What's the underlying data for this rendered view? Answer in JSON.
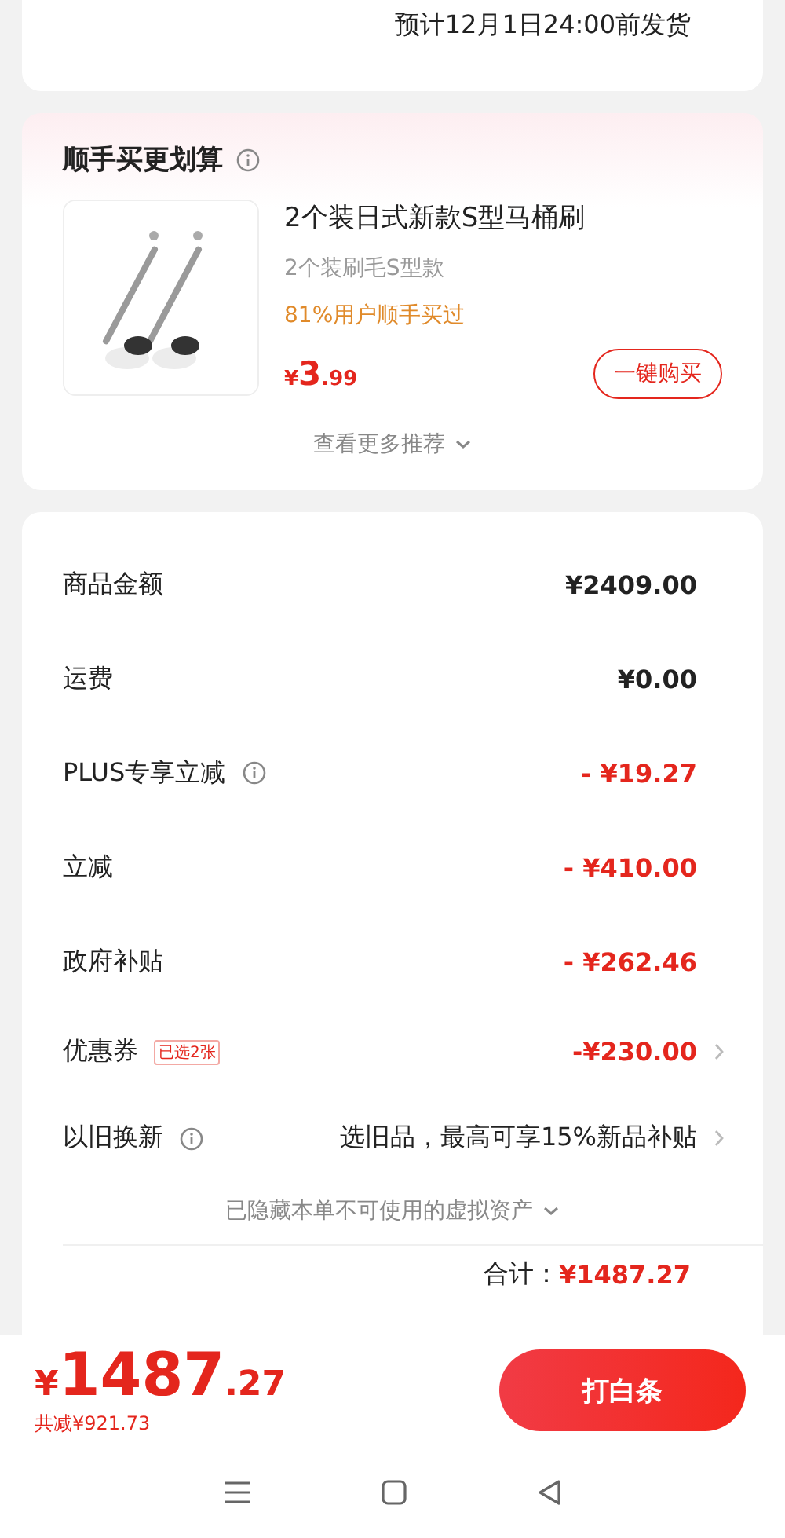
{
  "shipping": {
    "estimate": "预计12月1日24:00前发货"
  },
  "addon": {
    "title": "顺手买更划算",
    "product": {
      "kind": "picture",
      "name": "2个装日式新款S型马桶刷",
      "variant": "2个装刷毛S型款",
      "social_proof": "81%用户顺手买过",
      "currency": "¥",
      "price_int": "3",
      "price_dec": ".99",
      "buy_label": "一键购买"
    },
    "more": "查看更多推荐"
  },
  "summary": {
    "rows": [
      {
        "label": "商品金额",
        "info": false,
        "tag": null,
        "value": "¥2409.00",
        "negative": false,
        "arrow": false
      },
      {
        "label": "运费",
        "info": false,
        "tag": null,
        "value": "¥0.00",
        "negative": false,
        "arrow": false
      },
      {
        "label": "PLUS专享立减",
        "info": true,
        "tag": null,
        "value": "- ¥19.27",
        "negative": true,
        "arrow": false
      },
      {
        "label": "立减",
        "info": false,
        "tag": null,
        "value": "- ¥410.00",
        "negative": true,
        "arrow": false
      },
      {
        "label": "政府补贴",
        "info": false,
        "tag": null,
        "value": "- ¥262.46",
        "negative": true,
        "arrow": false
      },
      {
        "label": "优惠券",
        "info": false,
        "tag": "已选2张",
        "value": "-¥230.00",
        "negative": true,
        "arrow": true
      },
      {
        "label": "以旧换新",
        "info": true,
        "tag": null,
        "value": "选旧品，最高可享15%新品补贴",
        "negative": false,
        "arrow": true
      }
    ],
    "hidden_assets": "已隐藏本单不可使用的虚拟资产",
    "total_label": "合计：",
    "total_value": "¥1487.27"
  },
  "bottom_bar": {
    "currency": "¥",
    "price_int": "1487",
    "price_dec": ".27",
    "saved": "共减¥921.73",
    "pay_button": "打白条"
  }
}
